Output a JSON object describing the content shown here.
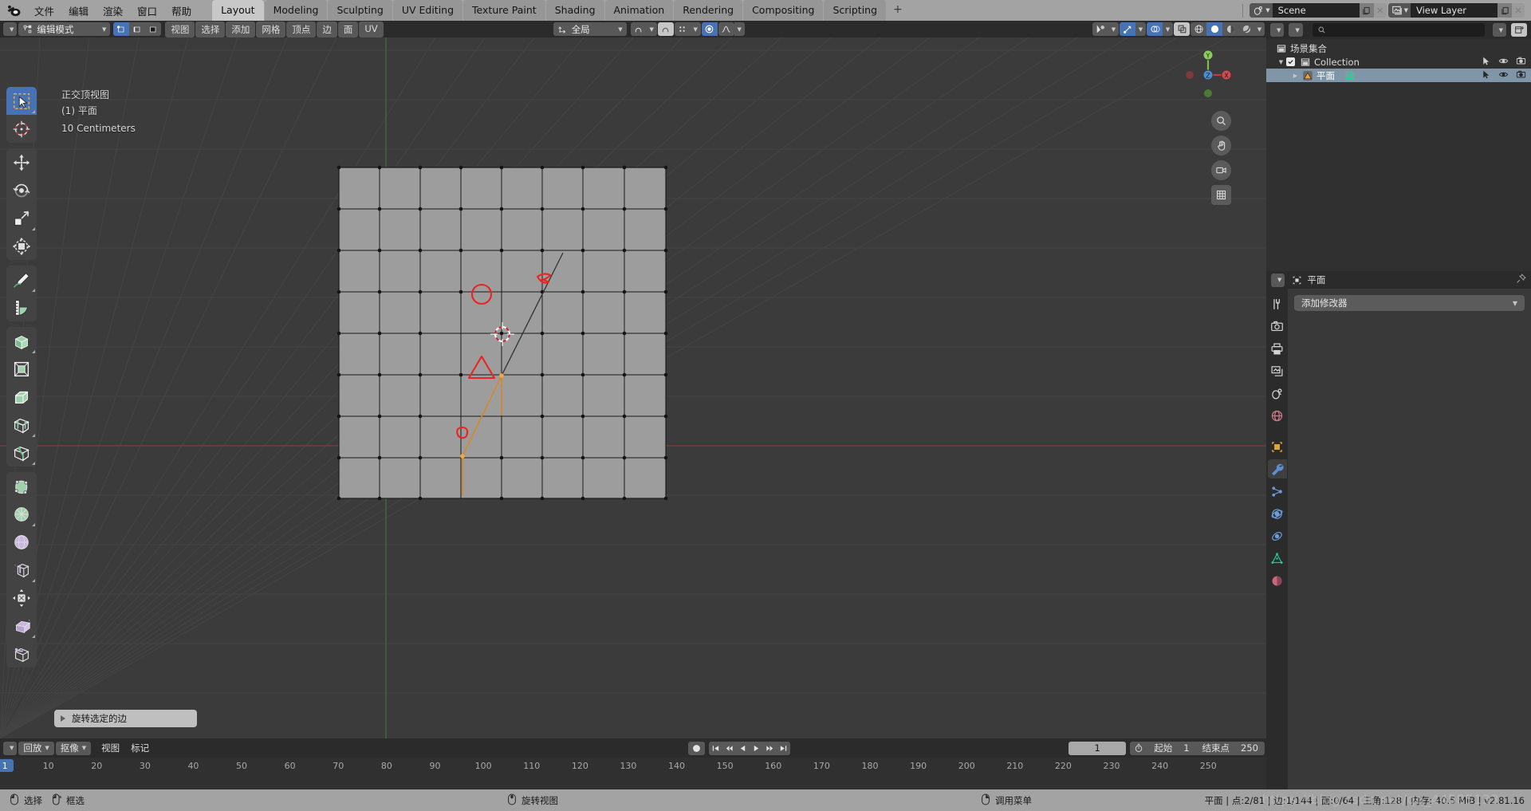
{
  "app": {
    "logo_icon": "blender-logo-icon",
    "menus": [
      "文件",
      "编辑",
      "渲染",
      "窗口",
      "帮助"
    ],
    "workspace_tabs": [
      {
        "label": "Layout",
        "active": true
      },
      {
        "label": "Modeling",
        "active": false
      },
      {
        "label": "Sculpting",
        "active": false
      },
      {
        "label": "UV Editing",
        "active": false
      },
      {
        "label": "Texture Paint",
        "active": false
      },
      {
        "label": "Shading",
        "active": false
      },
      {
        "label": "Animation",
        "active": false
      },
      {
        "label": "Rendering",
        "active": false
      },
      {
        "label": "Compositing",
        "active": false
      },
      {
        "label": "Scripting",
        "active": false
      },
      {
        "label": "+",
        "active": false
      }
    ],
    "scene": {
      "icon": "scene-icon",
      "name": "Scene",
      "copy_icon": "new-copy-icon",
      "close_icon": "x-icon"
    },
    "view_layer": {
      "icon": "view-layer-icon",
      "name": "View Layer",
      "copy_icon": "new-copy-icon",
      "close_icon": "x-icon"
    }
  },
  "viewport_header": {
    "editor_type_icon": "editor-type-3dview-icon",
    "mode": {
      "icon": "edit-mode-icon",
      "label": "编辑模式"
    },
    "select_modes": [
      {
        "name": "vertex-select-mode",
        "active": true
      },
      {
        "name": "edge-select-mode",
        "active": false
      },
      {
        "name": "face-select-mode",
        "active": false
      }
    ],
    "menus": [
      "视图",
      "选择",
      "添加",
      "网格",
      "顶点",
      "边",
      "面",
      "UV"
    ],
    "transform_orientation": {
      "icon": "orientation-icon",
      "label": "全局"
    },
    "snap": {
      "icon": "magnet-icon",
      "active": false
    },
    "snap_target": {
      "icon": "snap-grid-icon"
    },
    "proportional": {
      "icon": "proportional-edit-icon",
      "active": true,
      "falloff_icon": "smooth-falloff-icon"
    },
    "right": {
      "visibility_icon": "object-visibility-icon",
      "gizmo_icon": "gizmo-icon",
      "gizmo_active": true,
      "overlays_icon": "overlays-icon",
      "overlays_active": true,
      "xray_icon": "xray-icon",
      "xray_active": false,
      "shading_modes": [
        {
          "name": "wireframe-shading",
          "active": false
        },
        {
          "name": "solid-shading",
          "active": true
        },
        {
          "name": "material-preview-shading",
          "active": false
        },
        {
          "name": "rendered-shading",
          "active": false
        }
      ]
    }
  },
  "viewport": {
    "overlay_lines": [
      "正交顶视图",
      "(1) 平面",
      "10 Centimeters"
    ],
    "operator_panel": {
      "label": "旋转选定的边",
      "expand_icon": "triangle-right-icon"
    },
    "gizmo": {
      "axes": [
        "X",
        "Y",
        "Z"
      ]
    },
    "nav_buttons": [
      {
        "name": "zoom-nav-button",
        "icon": "zoom-icon"
      },
      {
        "name": "pan-nav-button",
        "icon": "hand-icon"
      },
      {
        "name": "camera-nav-button",
        "icon": "camera-icon"
      },
      {
        "name": "ortho-toggle-nav-button",
        "icon": "grid-icon"
      }
    ]
  },
  "toolbar": {
    "tools": [
      {
        "name": "tweak-tool",
        "icon": "select-box-icon",
        "active": true,
        "group": 0
      },
      {
        "name": "cursor-tool",
        "icon": "3d-cursor-icon",
        "active": false,
        "group": 0
      },
      {
        "name": "move-tool",
        "icon": "move-icon",
        "active": false,
        "group": 1
      },
      {
        "name": "rotate-tool",
        "icon": "rotate-icon",
        "active": false,
        "group": 1
      },
      {
        "name": "scale-tool",
        "icon": "scale-icon",
        "active": false,
        "group": 1
      },
      {
        "name": "transform-tool",
        "icon": "transform-icon",
        "active": false,
        "group": 1
      },
      {
        "name": "annotate-tool",
        "icon": "pencil-icon",
        "active": false,
        "group": 2
      },
      {
        "name": "measure-tool",
        "icon": "ruler-icon",
        "active": false,
        "group": 2
      },
      {
        "name": "extrude-region-tool",
        "icon": "extrude-icon",
        "active": false,
        "group": 3
      },
      {
        "name": "inset-faces-tool",
        "icon": "inset-icon",
        "active": false,
        "group": 3
      },
      {
        "name": "bevel-tool",
        "icon": "bevel-icon",
        "active": false,
        "group": 3
      },
      {
        "name": "loop-cut-tool",
        "icon": "loopcut-icon",
        "active": false,
        "group": 3
      },
      {
        "name": "knife-tool",
        "icon": "knife-icon",
        "active": false,
        "group": 3
      },
      {
        "name": "poly-build-tool",
        "icon": "polybuild-icon",
        "active": false,
        "group": 4
      },
      {
        "name": "spin-tool",
        "icon": "spin-icon",
        "active": false,
        "group": 4
      },
      {
        "name": "smooth-tool",
        "icon": "smooth-icon",
        "active": false,
        "group": 4
      },
      {
        "name": "edge-slide-tool",
        "icon": "edge-slide-icon",
        "active": false,
        "group": 4
      },
      {
        "name": "shrink-fatten-tool",
        "icon": "shrink-fatten-icon",
        "active": false,
        "group": 4
      },
      {
        "name": "shear-tool",
        "icon": "shear-icon",
        "active": false,
        "group": 4
      },
      {
        "name": "rip-region-tool",
        "icon": "rip-region-icon",
        "active": false,
        "group": 4
      }
    ]
  },
  "outliner": {
    "display_mode_icon": "outliner-display-mode-icon",
    "filter_id_icon": "filter-id-icon",
    "search_placeholder": "",
    "search_value": "",
    "filter_icon": "funnel-icon",
    "new_collection_icon": "new-collection-icon",
    "rows": [
      {
        "name": "scene-collection-row",
        "icon": "scene-collection-icon",
        "label": "场景集合",
        "indent": 0,
        "selected": false,
        "disclosure": "",
        "checkbox": false,
        "controls": []
      },
      {
        "name": "collection-row",
        "icon": "collection-icon",
        "label": "Collection",
        "indent": 1,
        "selected": false,
        "disclosure": "▼",
        "checkbox": true,
        "controls": [
          "cursor-arrow-icon",
          "eye-icon",
          "camera-icon"
        ]
      },
      {
        "name": "object-plane-row",
        "icon": "mesh-object-icon",
        "label": "平面",
        "indent": 2,
        "selected": true,
        "disclosure": "▶",
        "checkbox": false,
        "data_icon": "mesh-data-icon",
        "controls": [
          "cursor-arrow-icon",
          "eye-icon",
          "camera-icon"
        ]
      }
    ]
  },
  "properties": {
    "editor_icon": "properties-editor-icon",
    "breadcrumb_icon": "object-icon",
    "breadcrumb": "平面",
    "pin_icon": "pin-icon",
    "tabs": [
      {
        "name": "tool-tab",
        "icon": "tool-icon",
        "active": false
      },
      {
        "name": "render-tab",
        "icon": "render-camera-icon",
        "active": false
      },
      {
        "name": "output-tab",
        "icon": "printer-icon",
        "active": false
      },
      {
        "name": "view-layer-tab",
        "icon": "images-icon",
        "active": false
      },
      {
        "name": "scene-tab",
        "icon": "scene-cone-icon",
        "active": false
      },
      {
        "name": "world-tab",
        "icon": "world-globe-icon",
        "active": false
      },
      {
        "name": "object-tab",
        "icon": "object-square-icon",
        "active": false
      },
      {
        "name": "modifier-tab",
        "icon": "wrench-icon",
        "active": true
      },
      {
        "name": "particles-tab",
        "icon": "particles-icon",
        "active": false
      },
      {
        "name": "physics-tab",
        "icon": "physics-orbit-icon",
        "active": false
      },
      {
        "name": "constraints-tab",
        "icon": "constraint-icon",
        "active": false
      },
      {
        "name": "data-tab",
        "icon": "mesh-data-triangle-icon",
        "active": false
      },
      {
        "name": "material-tab",
        "icon": "material-sphere-icon",
        "active": false
      }
    ],
    "add_modifier": {
      "label": "添加修改器",
      "chevron_icon": "chevron-down-icon"
    }
  },
  "timeline": {
    "editor_icon": "timeline-editor-icon",
    "dropdowns": [
      {
        "name": "playback-menu",
        "label": "回放"
      },
      {
        "name": "keying-menu",
        "label": "抠像"
      }
    ],
    "menus": [
      "视图",
      "标记"
    ],
    "record_icon": "record-icon",
    "transport": [
      {
        "name": "jump-start-button",
        "icon": "jump-to-start-icon"
      },
      {
        "name": "prev-keyframe-button",
        "icon": "prev-keyframe-icon"
      },
      {
        "name": "play-reverse-button",
        "icon": "play-reverse-icon"
      },
      {
        "name": "play-button",
        "icon": "play-icon"
      },
      {
        "name": "next-keyframe-button",
        "icon": "next-keyframe-icon"
      },
      {
        "name": "jump-end-button",
        "icon": "jump-to-end-icon"
      }
    ],
    "current_frame_field": "1",
    "clock_icon": "stopwatch-icon",
    "start_label": "起始",
    "start_value": "1",
    "end_label": "结束点",
    "end_value": "250",
    "playhead_frame": "1",
    "ruler_ticks": [
      "10",
      "20",
      "30",
      "40",
      "50",
      "60",
      "70",
      "80",
      "90",
      "100",
      "110",
      "120",
      "130",
      "140",
      "150",
      "160",
      "170",
      "180",
      "190",
      "200",
      "210",
      "220",
      "230",
      "240",
      "250"
    ],
    "ruler_min": 0,
    "ruler_max": 262
  },
  "statusbar": {
    "hints": [
      {
        "name": "select-hint",
        "icon": "mouse-left-icon",
        "label": "选择"
      },
      {
        "name": "box-select-hint",
        "icon": "mouse-left-drag-icon",
        "label": "框选"
      },
      {
        "name": "rotate-view-hint",
        "icon": "mouse-middle-icon",
        "label": "旋转视图"
      },
      {
        "name": "call-menu-hint",
        "icon": "mouse-right-icon",
        "label": "调用菜单"
      }
    ],
    "stats": "平面 | 点:2/81 | 边:1/144 | 面:0/64 | 三角:128  | 内存: 40.5 MiB | v2.81.16",
    "watermark": "https://blog.csdn.net/qq_44585133"
  },
  "colors": {
    "accent": "#4772b3",
    "header": "#a3a3a3",
    "viewport_bg": "#3b3b3b",
    "panel_bg": "#303030",
    "selected_row": "#8096a8",
    "annotation_red": "#ee2222",
    "active_edge": "#e08a2a"
  }
}
